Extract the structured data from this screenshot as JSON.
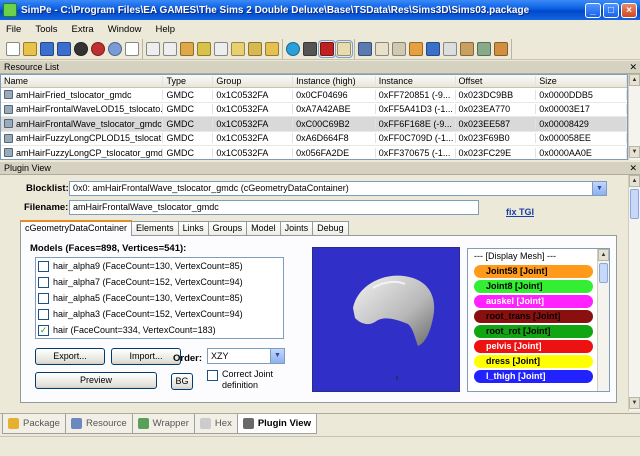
{
  "window": {
    "title": "SimPe - C:\\Program Files\\EA GAMES\\The Sims 2 Double Deluxe\\Base\\TSData\\Res\\Sims3D\\Sims03.package"
  },
  "menu": [
    "File",
    "Tools",
    "Extra",
    "Window",
    "Help"
  ],
  "resource_list": {
    "header": "Resource List",
    "columns": [
      "Name",
      "Type",
      "Group",
      "Instance (high)",
      "Instance",
      "Offset",
      "Size"
    ],
    "rows": [
      [
        "amHairFried_tslocator_gmdc",
        "GMDC",
        "0x1C0532FA",
        "0x0CF04696",
        "0xFF720851 (-9...",
        "0x023DC9BB",
        "0x0000DDB5"
      ],
      [
        "amHairFrontalWaveLOD15_tslocato...",
        "GMDC",
        "0x1C0532FA",
        "0xA7A42ABE",
        "0xFF5A41D3 (-1...",
        "0x023EA770",
        "0x00003E17"
      ],
      [
        "amHairFrontalWave_tslocator_gmdc",
        "GMDC",
        "0x1C0532FA",
        "0xC00C69B2",
        "0xFF6F168E (-9...",
        "0x023EE587",
        "0x00008429"
      ],
      [
        "amHairFuzzyLongCPLOD15_tslocat...",
        "GMDC",
        "0x1C0532FA",
        "0xA6D664F8",
        "0xFF0C709D (-1...",
        "0x023F69B0",
        "0x000058EE"
      ],
      [
        "amHairFuzzyLongCP_tslocator_gmdc",
        "GMDC",
        "0x1C0532FA",
        "0x056FA2DE",
        "0xFF370675 (-1...",
        "0x023FC29E",
        "0x0000AA0E"
      ]
    ]
  },
  "plugin": {
    "header": "Plugin View",
    "blocklist_label": "Blocklist:",
    "blocklist_value": "0x0: amHairFrontalWave_tslocator_gmdc (cGeometryDataContainer)",
    "filename_label": "Filename:",
    "filename_value": "amHairFrontalWave_tslocator_gmdc",
    "fix_tgi": "fix TGI",
    "tabs": [
      "cGeometryDataContainer",
      "Elements",
      "Links",
      "Groups",
      "Model",
      "Joints",
      "Debug"
    ],
    "models_label": "Models (Faces=898, Vertices=541):",
    "meshes": [
      {
        "label": "hair_alpha9 (FaceCount=130, VertexCount=85)",
        "checked": false
      },
      {
        "label": "hair_alpha7 (FaceCount=152, VertexCount=94)",
        "checked": false
      },
      {
        "label": "hair_alpha5 (FaceCount=130, VertexCount=85)",
        "checked": false
      },
      {
        "label": "hair_alpha3 (FaceCount=152, VertexCount=94)",
        "checked": false
      },
      {
        "label": "hair (FaceCount=334, VertexCount=183)",
        "checked": true
      }
    ],
    "export_label": "Export...",
    "import_label": "Import...",
    "preview_label": "Preview",
    "order_label": "Order:",
    "order_value": "XZY",
    "bg_label": "BG",
    "correct_joint_label": "Correct Joint definition",
    "display_mesh_label": "--- [Display Mesh] ---",
    "joints": [
      {
        "label": "Joint58 [Joint]",
        "color": "#ff9a1a",
        "text": "#000"
      },
      {
        "label": "Joint8 [Joint]",
        "color": "#33ee33",
        "text": "#000"
      },
      {
        "label": "auskel [Joint]",
        "color": "#ff22ff",
        "text": "#fff"
      },
      {
        "label": "root_trans [Joint]",
        "color": "#8a1010",
        "text": "#000"
      },
      {
        "label": "root_rot [Joint]",
        "color": "#11a611",
        "text": "#000"
      },
      {
        "label": "pelvis [Joint]",
        "color": "#ee1111",
        "text": "#fff"
      },
      {
        "label": "dress [Joint]",
        "color": "#ffff00",
        "text": "#000"
      },
      {
        "label": "l_thigh [Joint]",
        "color": "#2222ff",
        "text": "#fff"
      }
    ]
  },
  "bottom_tabs": [
    "Package",
    "Resource",
    "Wrapper",
    "Hex",
    "Plugin View"
  ],
  "colors": {
    "titlebar": "#0a5ee0",
    "viewport_bg": "#3030c8",
    "active_tab_accent": "#e68b2c"
  }
}
